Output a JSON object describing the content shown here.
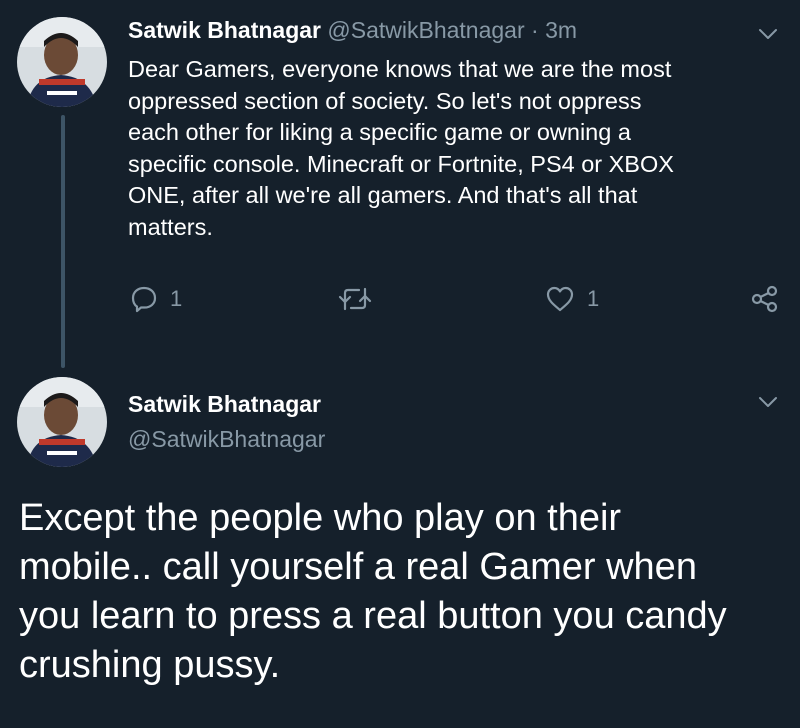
{
  "tweet_1": {
    "display_name": "Satwik Bhatnagar",
    "handle": "@SatwikBhatnagar",
    "separator": "·",
    "time": "3m",
    "text": "Dear Gamers, everyone knows that we are the most\noppressed section of society. So let's not oppress\neach other for liking a specific game or owning a\nspecific console. Minecraft or Fortnite, PS4 or XBOX\nONE, after all we're all gamers. And that's all that\nmatters.",
    "reply_count": "1",
    "retweet_count": "",
    "like_count": "1",
    "icons": {
      "reply": "reply-icon",
      "retweet": "retweet-icon",
      "like": "heart-icon",
      "share": "share-icon",
      "menu": "chevron-down-icon"
    }
  },
  "tweet_2": {
    "display_name": "Satwik Bhatnagar",
    "handle": "@SatwikBhatnagar",
    "text": "Except the people who play on their\nmobile.. call yourself a real Gamer when\nyou learn to press a real button you candy\ncrushing pussy.",
    "icons": {
      "menu": "chevron-down-icon"
    }
  },
  "colors": {
    "background": "#15202b",
    "text_primary": "#ffffff",
    "text_secondary": "#8899a6",
    "thread_line": "#3d5466"
  }
}
